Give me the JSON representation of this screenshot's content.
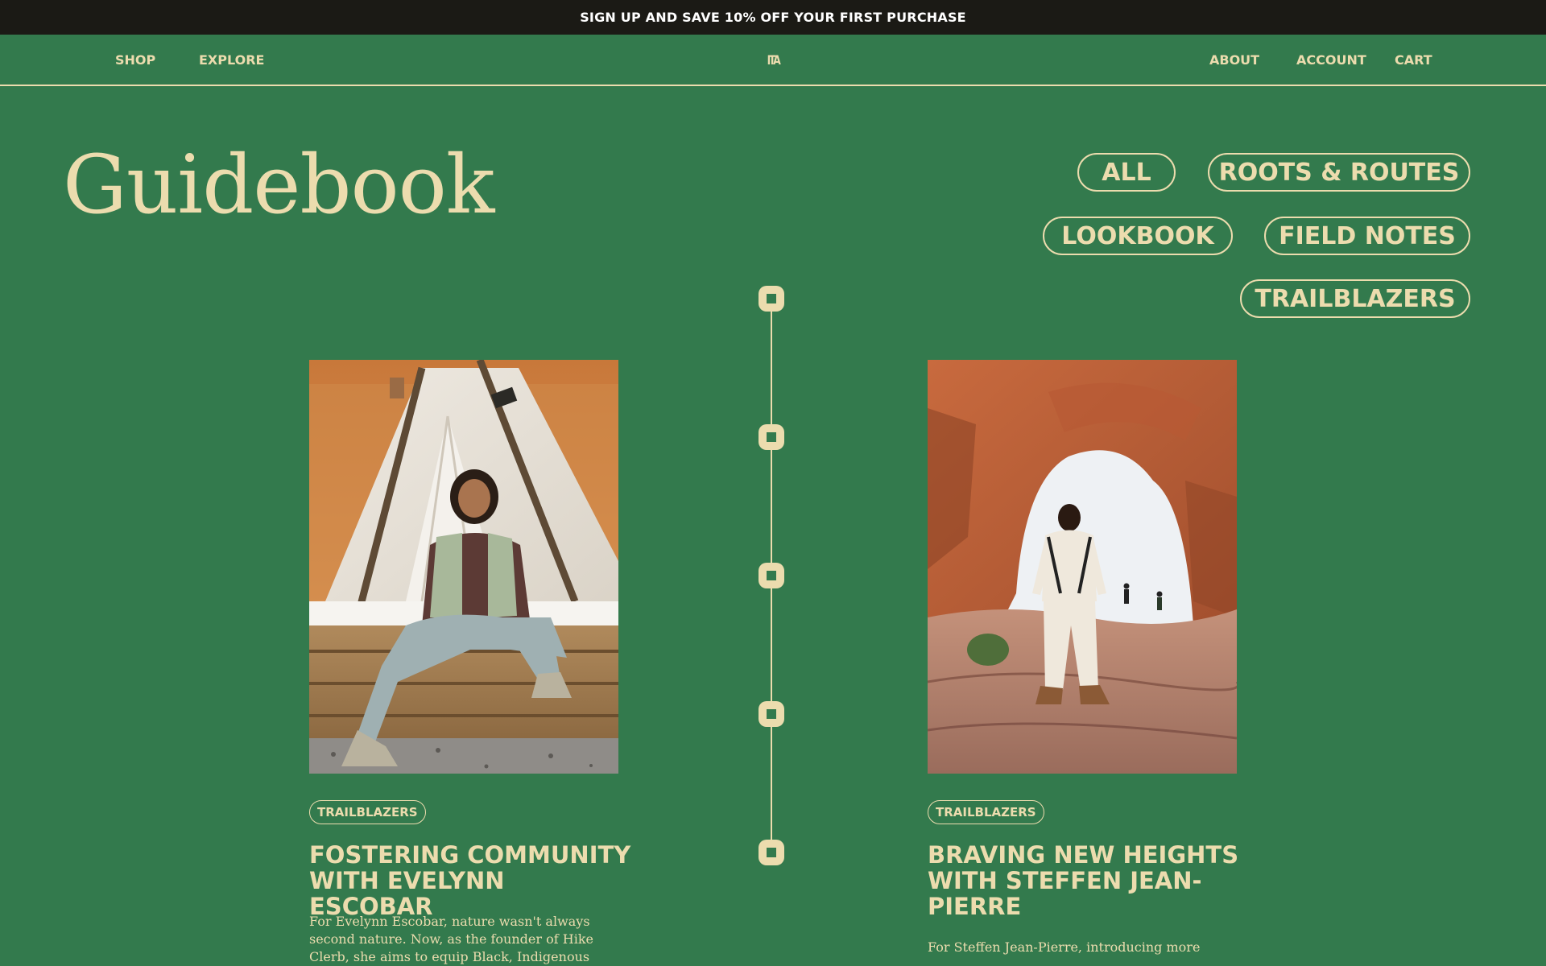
{
  "announcement": "SIGN UP AND SAVE 10% OFF YOUR FIRST PURCHASE",
  "nav": {
    "shop": "SHOP",
    "explore": "EXPLORE",
    "logo": "ITA",
    "about": "ABOUT",
    "account": "ACCOUNT",
    "cart": "CART"
  },
  "page_title": "Guidebook",
  "filters": [
    "ALL",
    "ROOTS & ROUTES",
    "LOOKBOOK",
    "FIELD NOTES",
    "TRAILBLAZERS"
  ],
  "cards": [
    {
      "tag": "TRAILBLAZERS",
      "title": "FOSTERING COMMUNITY WITH EVELYNN ESCOBAR",
      "excerpt": "For Evelynn Escobar, nature wasn't always second nature. Now, as the founder of Hike Clerb, she aims to equip Black, Indigenous"
    },
    {
      "tag": "TRAILBLAZERS",
      "title": "BRAVING NEW HEIGHTS WITH STEFFEN JEAN-PIERRE",
      "excerpt": "For Steffen Jean-Pierre, introducing more"
    }
  ],
  "colors": {
    "background": "#337a4d",
    "cream": "#ecdcae",
    "topbar": "#1b1a15"
  }
}
